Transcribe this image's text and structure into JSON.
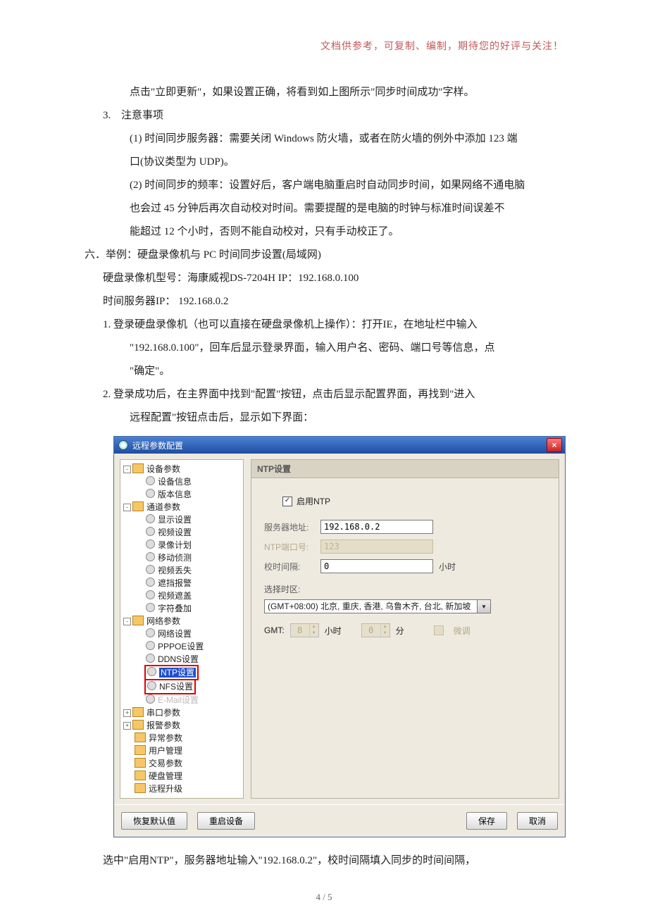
{
  "header_note": "文档供参考，可复制、编制，期待您的好评与关注！",
  "body": {
    "p0": "点击\"立即更新\"，如果设置正确，将看到如上图所示\"同步时间成功\"字样。",
    "li3_label": "3.",
    "li3_text": "注意事项",
    "p_1_1": "(1) 时间同步服务器：需要关闭 Windows 防火墙，或者在防火墙的例外中添加 123 端",
    "p_1_1b": "口(协议类型为 UDP)。",
    "p_1_2": "(2) 时间同步的频率：设置好后，客户端电脑重启时自动同步时间，如果网络不通电脑",
    "p_1_2b": "也会过 45 分钟后再次自动校对时间。需要提醒的是电脑的时钟与标准时间误差不",
    "p_1_2c": "能超过 12 个小时，否则不能自动校对，只有手动校正了。",
    "sec6_label": "六．",
    "sec6_text": "举例：硬盘录像机与 PC 时间同步设置(局域网)",
    "dvr": "硬盘录像机型号：海康威视DS-7204H      IP：192.168.0.100",
    "srv": "时间服务器IP：   192.168.0.2",
    "step1a": "1. 登录硬盘录像机（也可以直接在硬盘录像机上操作）：打开IE，在地址栏中输入",
    "step1b": "\"192.168.0.100\"，回车后显示登录界面，输入用户名、密码、端口号等信息，点",
    "step1c": "\"确定\"。",
    "step2a": "2. 登录成功后，在主界面中找到\"配置\"按钮，点击后显示配置界面，再找到\"进入",
    "step2b": "远程配置\"按钮点击后，显示如下界面：",
    "after_dialog": "选中\"启用NTP\"，服务器地址输入\"192.168.0.2\"，校时间隔填入同步的时间间隔，"
  },
  "dialog": {
    "title": "远程参数配置",
    "close": "×",
    "tree": {
      "n0": "设备参数",
      "n0_0": "设备信息",
      "n0_1": "版本信息",
      "n1": "通道参数",
      "n1_0": "显示设置",
      "n1_1": "视频设置",
      "n1_2": "录像计划",
      "n1_3": "移动侦测",
      "n1_4": "视频丢失",
      "n1_5": "遮挡报警",
      "n1_6": "视频遮盖",
      "n1_7": "字符叠加",
      "n2": "网络参数",
      "n2_0": "网络设置",
      "n2_1": "PPPOE设置",
      "n2_2": "DDNS设置",
      "n2_3": "NTP设置",
      "n2_4": "NFS设置",
      "n2_5": "E-Mail设置",
      "n3": "串口参数",
      "n4": "报警参数",
      "n5": "异常参数",
      "n6": "用户管理",
      "n7": "交易参数",
      "n8": "硬盘管理",
      "n9": "远程升级"
    },
    "panel": {
      "title": "NTP设置",
      "enable_label": "启用NTP",
      "server_label": "服务器地址:",
      "server_value": "192.168.0.2",
      "port_label": "NTP端口号:",
      "port_value": "123",
      "interval_label": "校时间隔:",
      "interval_value": "0",
      "interval_unit": "小时",
      "tz_label": "选择时区:",
      "tz_value": "(GMT+08:00) 北京, 重庆, 香港, 乌鲁木齐, 台北, 新加坡",
      "gmt_label": "GMT:",
      "gmt_h": "8",
      "gmt_h_unit": "小时",
      "gmt_m": "0",
      "gmt_m_unit": "分",
      "fine_label": "微调"
    },
    "buttons": {
      "restore": "恢复默认值",
      "reboot": "重启设备",
      "save": "保存",
      "cancel": "取消"
    }
  },
  "footer": "4 / 5"
}
